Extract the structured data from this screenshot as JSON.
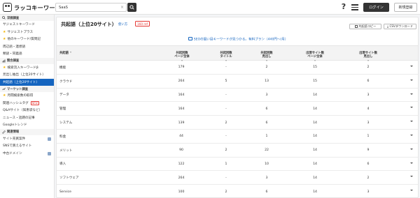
{
  "app": {
    "logo_text": "ラッコキーワード",
    "search_value": "SaaS",
    "login_label": "ログイン",
    "signup_label": "新規登録"
  },
  "sidebar": {
    "sections": [
      {
        "title": "深掘調査",
        "items": [
          {
            "label": "サジェストキーワード",
            "star": false
          },
          {
            "label": "サジェストプラス",
            "star": true
          },
          {
            "label": "他のキーワード/質問記",
            "star": true
          },
          {
            "label": "周辺語・連想語",
            "star": false
          },
          {
            "label": "類語・同義語",
            "star": false
          }
        ]
      },
      {
        "title": "競合調査",
        "items": [
          {
            "label": "検索流入キーワードβ",
            "star": true
          },
          {
            "label": "見出し抽出（上位20サイト）",
            "star": false
          },
          {
            "label": "共起語（上位20サイト）",
            "star": false,
            "active": true
          }
        ]
      },
      {
        "title": "マーケット調査",
        "items": [
          {
            "label": "月間検索数の取得",
            "star": true
          },
          {
            "label": "関連ハッシュタグ",
            "star": false,
            "badge": "NEW"
          },
          {
            "label": "Q&Aサイト（知恵袋など）",
            "star": false
          },
          {
            "label": "ニュース・話題の記事",
            "star": false
          },
          {
            "label": "Googleトレンド",
            "star": false
          }
        ]
      },
      {
        "title": "関連情報",
        "items": [
          {
            "label": "サイト売買案件",
            "star": false,
            "ext": true
          },
          {
            "label": "SNSで買えるサイト",
            "star": false
          },
          {
            "label": "中古ドメイン",
            "star": false,
            "ext": true
          }
        ]
      }
    ]
  },
  "panel": {
    "title": "共起語（上位20サイト）",
    "howto": "使い方",
    "ref_badge": "160 ref",
    "copy_label": "共起語コピー",
    "csv_label": "CSVダウンロード",
    "promo_text": "SEOの狙い目キーワードが見つかる。有料プラン（440円〜/月）"
  },
  "table": {
    "headers": [
      {
        "label": "共起語",
        "sort": true
      },
      {
        "label": "共起回数\nページ全体",
        "sort": true
      },
      {
        "label": "共起回数\nタイトル",
        "sort": true
      },
      {
        "label": "共起回数\n見出し",
        "sort": true
      },
      {
        "label": "出現サイト数\nページ全体",
        "sort": true
      },
      {
        "label": "出現サイト数\n見出し",
        "sort": true
      }
    ],
    "rows": [
      {
        "word": "機能",
        "page_total": "179",
        "title": "-",
        "heading": "2",
        "sites_page": "15",
        "sites_heading": "2"
      },
      {
        "word": "クラウド",
        "page_total": "264",
        "title": "5",
        "heading": "13",
        "sites_page": "15",
        "sites_heading": "6"
      },
      {
        "word": "データ",
        "page_total": "164",
        "title": "-",
        "heading": "3",
        "sites_page": "14",
        "sites_heading": "3"
      },
      {
        "word": "管理",
        "page_total": "164",
        "title": "-",
        "heading": "6",
        "sites_page": "14",
        "sites_heading": "4"
      },
      {
        "word": "システム",
        "page_total": "139",
        "title": "2",
        "heading": "6",
        "sites_page": "14",
        "sites_heading": "3"
      },
      {
        "word": "料金",
        "page_total": "44",
        "title": "-",
        "heading": "1",
        "sites_page": "14",
        "sites_heading": "1"
      },
      {
        "word": "メリット",
        "page_total": "90",
        "title": "2",
        "heading": "22",
        "sites_page": "14",
        "sites_heading": "9"
      },
      {
        "word": "導入",
        "page_total": "122",
        "title": "1",
        "heading": "10",
        "sites_page": "14",
        "sites_heading": "6"
      },
      {
        "word": "ソフトウェア",
        "page_total": "264",
        "title": "-",
        "heading": "3",
        "sites_page": "14",
        "sites_heading": "2"
      },
      {
        "word": "Service",
        "page_total": "100",
        "title": "2",
        "heading": "6",
        "sites_page": "14",
        "sites_heading": "3"
      }
    ]
  }
}
